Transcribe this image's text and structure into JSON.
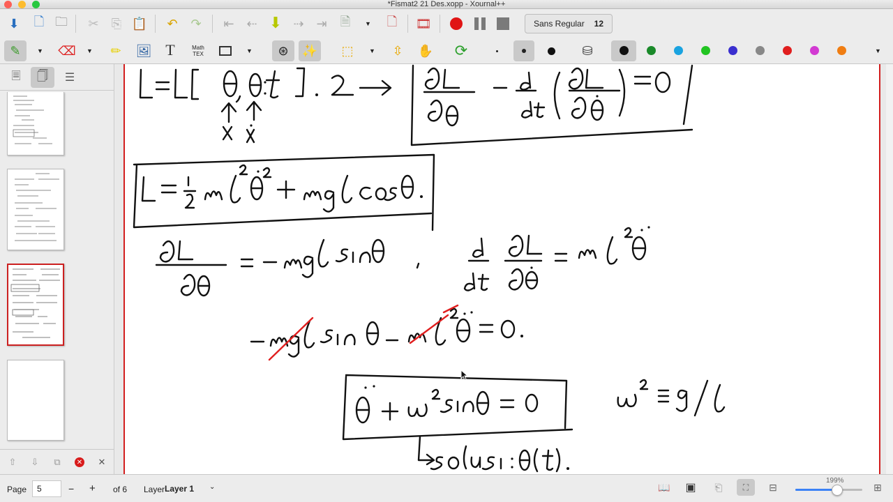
{
  "window": {
    "title": "*Fismat2 21 Des.xopp - Xournal++"
  },
  "toolbar1": {
    "font_name": "Sans Regular",
    "font_size": "12"
  },
  "toolbar2": {
    "math_tex_label_line1": "Math",
    "math_tex_label_line2": "TEX",
    "text_tool_label": "T",
    "colors": [
      "#111111",
      "#1a8a2a",
      "#1aa3e0",
      "#22c422",
      "#3a2fcf",
      "#888888",
      "#e01e1e",
      "#d23ad2",
      "#f07d12"
    ]
  },
  "statusbar": {
    "page_label": "Page",
    "page_value": "5",
    "minus_label": "−",
    "plus_label": "+",
    "of_pages": "of 6",
    "layer_label": "Layer",
    "layer_value": "Layer 1",
    "zoom_percent": "199%",
    "zoom_fraction": 0.62
  },
  "sidebar": {
    "selected_page": 5
  }
}
